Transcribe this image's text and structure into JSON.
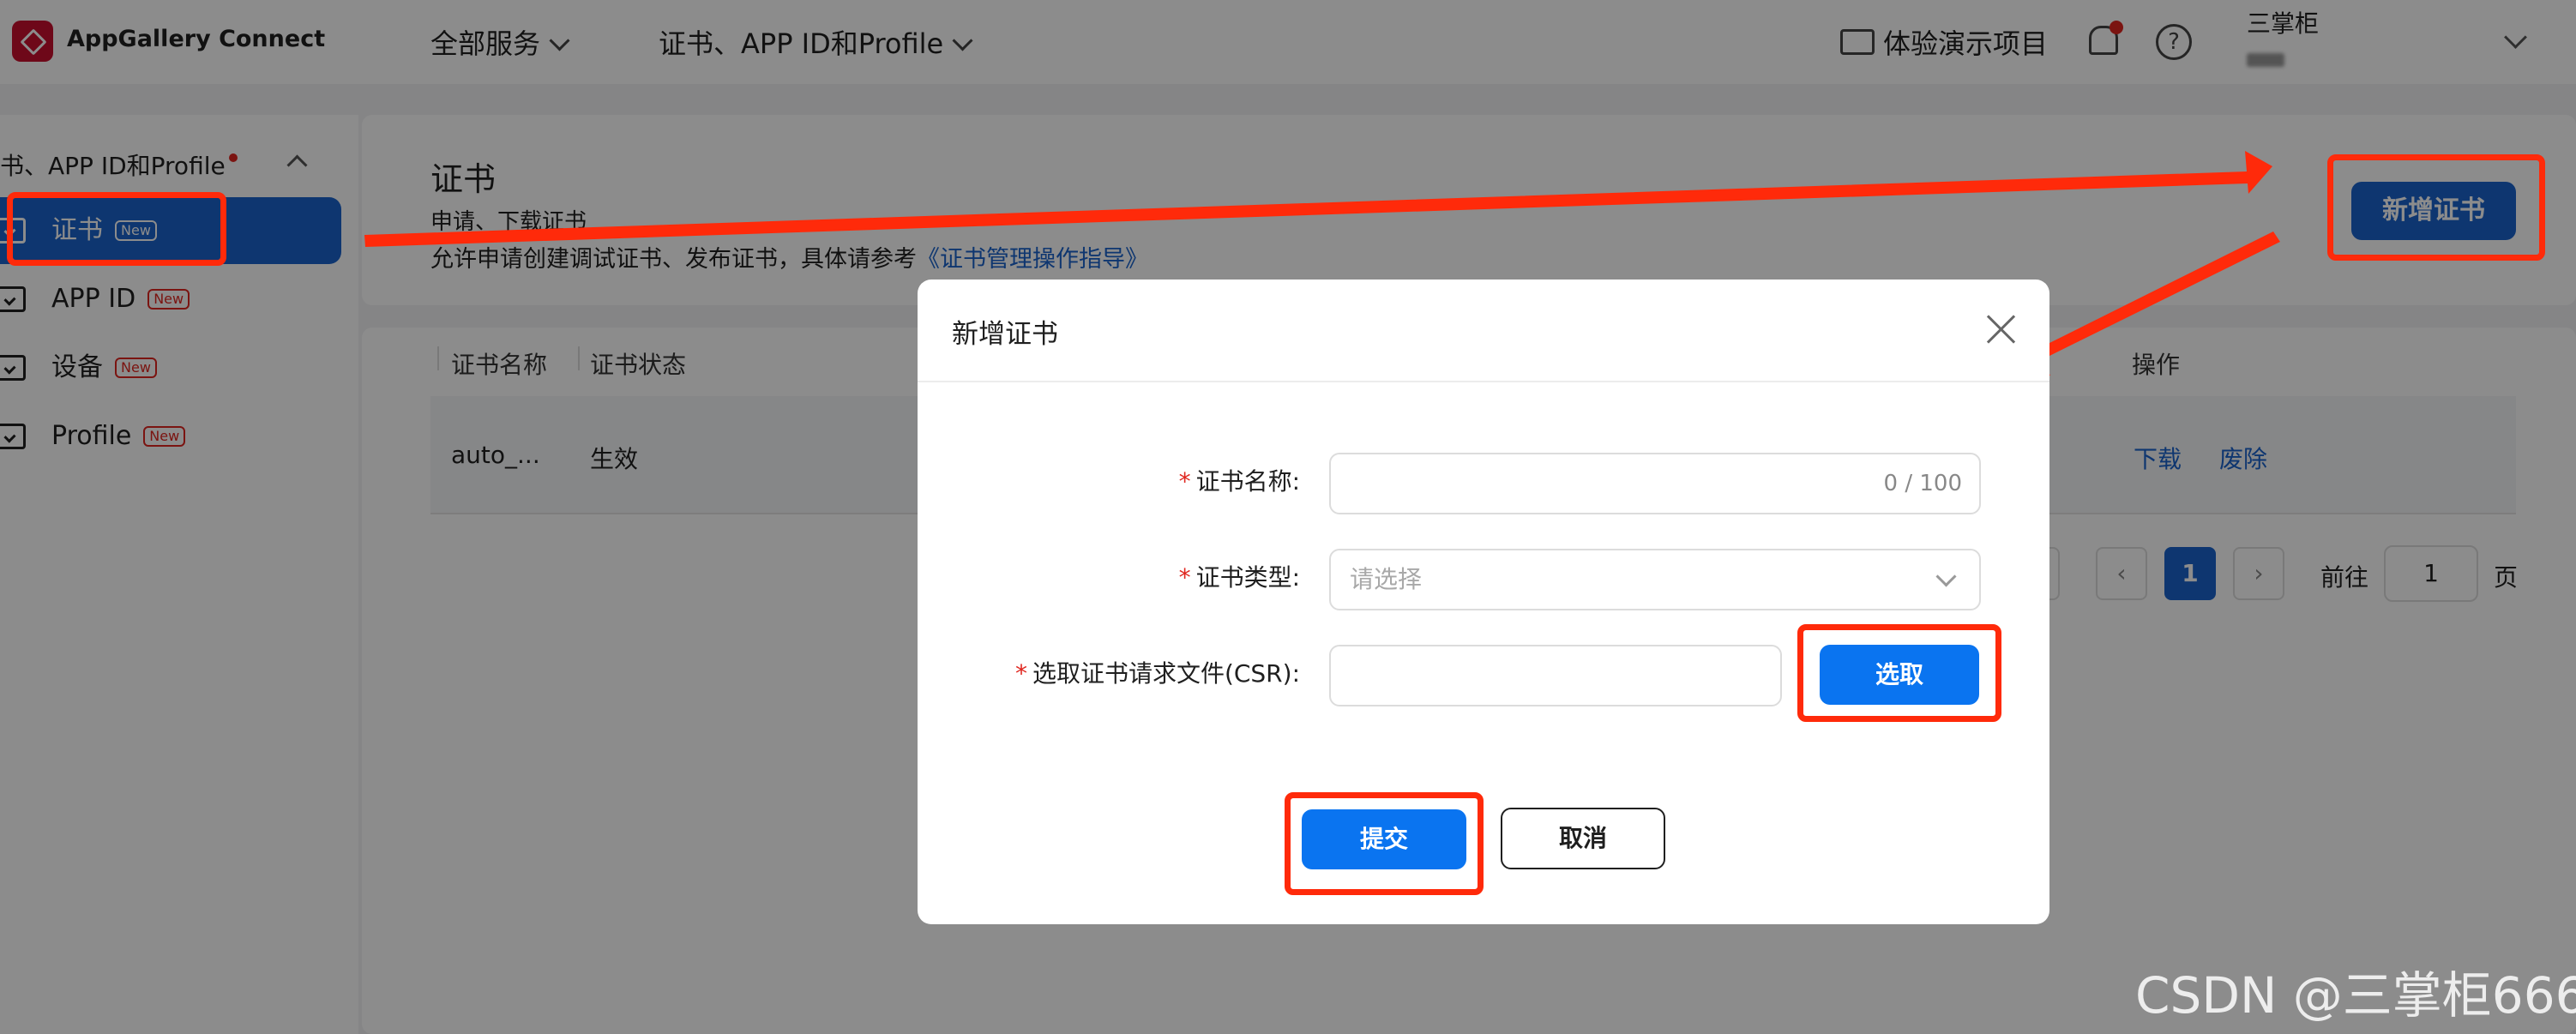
{
  "header": {
    "brand": "AppGallery Connect",
    "nav": [
      {
        "label": "全部服务"
      },
      {
        "label": "证书、APP ID和Profile"
      }
    ],
    "demo": "体验演示项目",
    "help": "?",
    "user": "三掌柜"
  },
  "sidebar": {
    "group_label": "书、APP ID和Profile",
    "items": [
      {
        "label": "证书",
        "badge": "New"
      },
      {
        "label": "APP ID",
        "badge": "New"
      },
      {
        "label": "设备",
        "badge": "New"
      },
      {
        "label": "Profile",
        "badge": "New"
      }
    ]
  },
  "page": {
    "title": "证书",
    "subtitle": "申请、下载证书",
    "description": "允许申请创建调试证书、发布证书，具体请参考",
    "guide_link": "《证书管理操作指导》",
    "new_button": "新增证书"
  },
  "table": {
    "columns": [
      "证书名称",
      "证书状态",
      "操作"
    ],
    "rows": [
      {
        "name": "auto_...",
        "status": "生效",
        "actions": [
          "下载",
          "废除"
        ]
      }
    ]
  },
  "pagination": {
    "prev": "‹",
    "current": "1",
    "next": "›",
    "goto_label": "前往",
    "goto_value": "1",
    "page_label": "页"
  },
  "dialog": {
    "title": "新增证书",
    "fields": {
      "name_label": "证书名称:",
      "name_counter": "0 / 100",
      "type_label": "证书类型:",
      "type_placeholder": "请选择",
      "csr_label": "选取证书请求文件(CSR):"
    },
    "required_mark": "*",
    "select_button": "选取",
    "submit_button": "提交",
    "cancel_button": "取消"
  },
  "watermark": "CSDN @三掌柜666",
  "colors": {
    "primary": "#0a74f0",
    "sidebar_active": "#1a63cc",
    "highlight": "#ff2a0a",
    "required": "#e0261f"
  }
}
